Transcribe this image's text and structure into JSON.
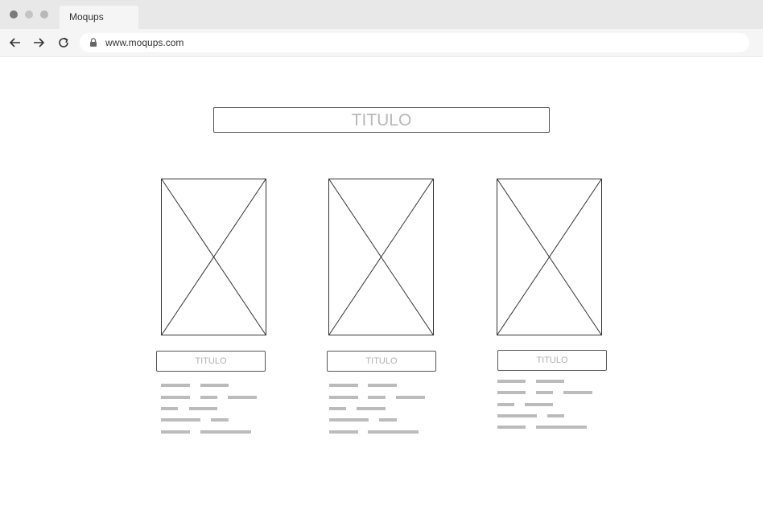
{
  "browser": {
    "tab_title": "Moqups",
    "url": "www.moqups.com"
  },
  "page": {
    "main_title": "TITULO",
    "cards": [
      {
        "title": "TITULO"
      },
      {
        "title": "TITULO"
      },
      {
        "title": "TITULO"
      }
    ]
  }
}
